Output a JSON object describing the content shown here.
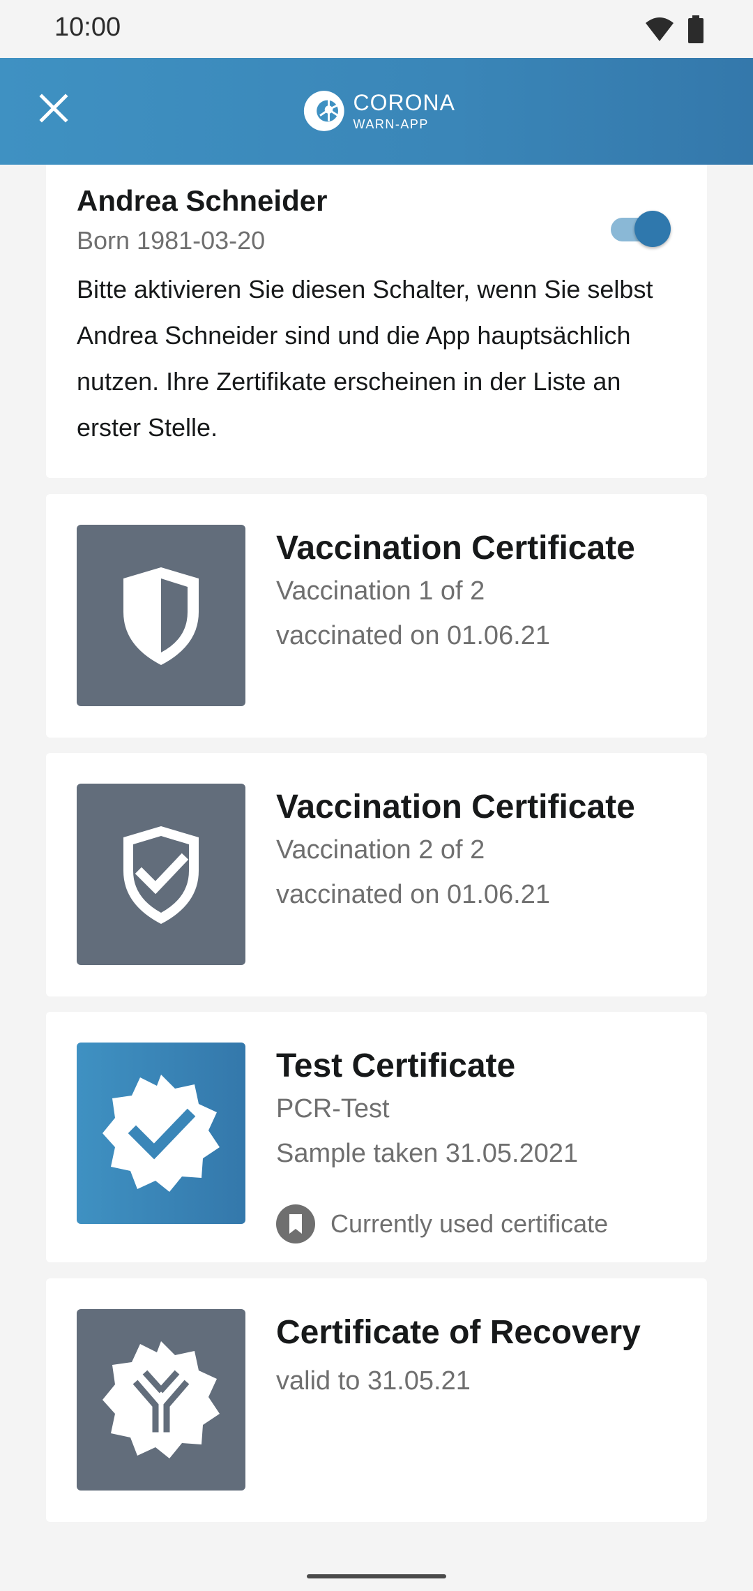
{
  "status_bar": {
    "time": "10:00"
  },
  "app_bar": {
    "logo_line1": "CORONA",
    "logo_line2": "WARN-APP"
  },
  "person": {
    "name": "Andrea Schneider",
    "born": "Born 1981-03-20",
    "description": "Bitte aktivieren Sie diesen Schalter, wenn Sie selbst Andrea Schneider sind und die App hauptsächlich nutzen. Ihre Zertifikate erscheinen in der Liste an erster Stelle.",
    "toggle_on": true
  },
  "certificates": [
    {
      "title": "Vaccination Certificate",
      "line1": "Vaccination 1 of 2",
      "line2": "vaccinated on 01.06.21",
      "icon": "half-shield-icon"
    },
    {
      "title": "Vaccination Certificate",
      "line1": "Vaccination 2 of 2",
      "line2": "vaccinated on 01.06.21",
      "icon": "shield-check-icon"
    },
    {
      "title": "Test Certificate",
      "line1": "PCR-Test",
      "line2": "Sample taken 31.05.2021",
      "badge": "Currently used certificate",
      "icon": "badge-check-icon"
    },
    {
      "title": "Certificate of Recovery",
      "line1": "valid to 31.05.21",
      "icon": "antibody-badge-icon"
    }
  ],
  "colors": {
    "brand_blue": "#3f91c2",
    "icon_gray": "#626d7b"
  }
}
